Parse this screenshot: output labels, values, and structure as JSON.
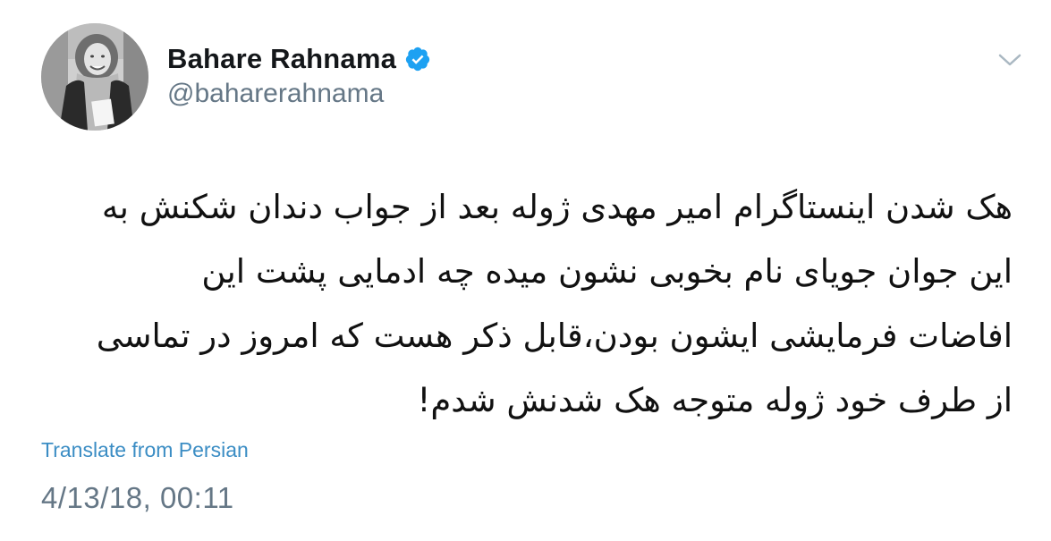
{
  "author": {
    "display_name": "Bahare Rahnama",
    "handle": "@baharerahnama",
    "verified": true,
    "avatar_icon": "profile-photo"
  },
  "tweet": {
    "lines": [
      "هک شدن اینستاگرام امیر مهدی ژوله بعد از جواب دندان شکنش به",
      "این جوان جویای نام بخوبی نشون میده چه ادمایی پشت این",
      "افاضات فرمایشی ایشون بودن،قابل ذکر هست که امروز در تماسی",
      "از طرف خود ژوله متوجه هک شدنش شدم!"
    ],
    "translate_label": "Translate from Persian",
    "timestamp": "4/13/18, 00:11"
  },
  "colors": {
    "verified_badge": "#1da1f2",
    "translate_link": "#3b8dc4",
    "secondary_text": "#657786",
    "primary_text": "#14171a"
  },
  "icons": {
    "verified": "verified-badge-icon",
    "menu": "chevron-down-icon"
  }
}
